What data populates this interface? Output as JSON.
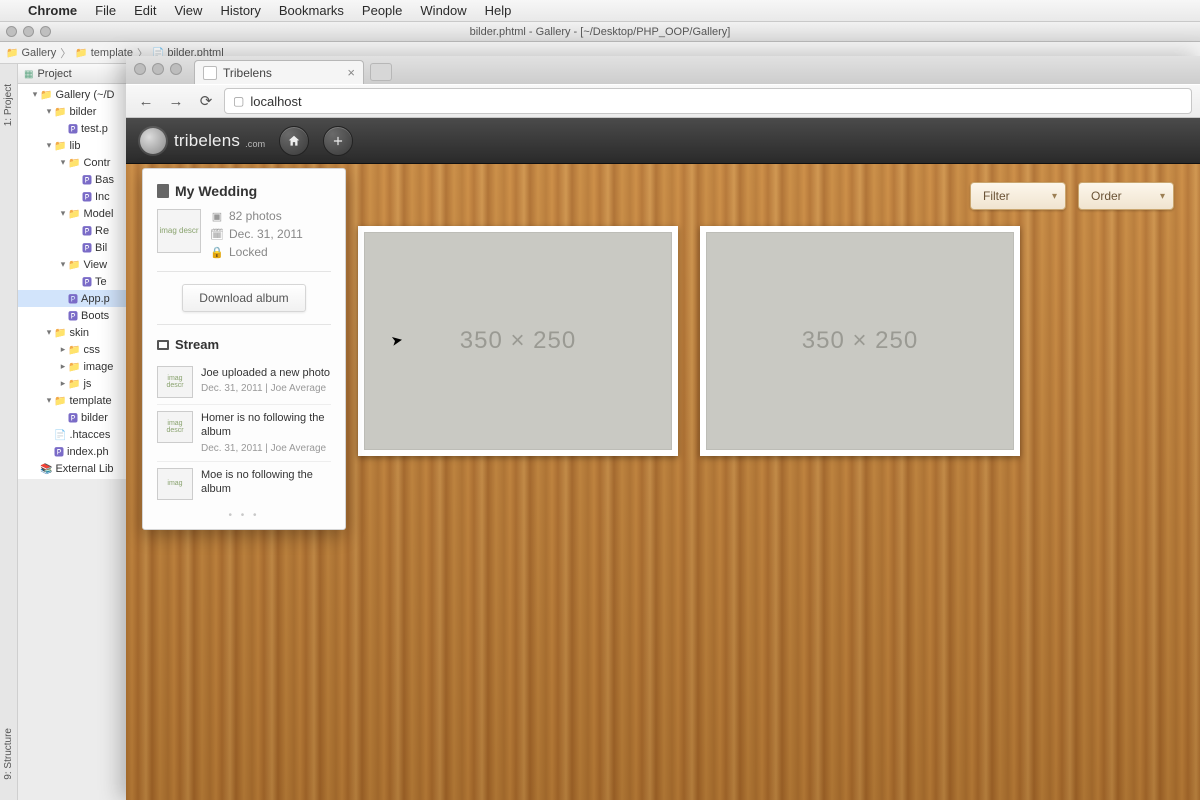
{
  "mac_menu": {
    "app": "Chrome",
    "items": [
      "File",
      "Edit",
      "View",
      "History",
      "Bookmarks",
      "People",
      "Window",
      "Help"
    ]
  },
  "ide": {
    "title": "bilder.phtml - Gallery - [~/Desktop/PHP_OOP/Gallery]",
    "breadcrumb": [
      "Gallery",
      "template",
      "bilder.phtml"
    ],
    "project_label": "Project",
    "left_tabs": [
      "1: Project",
      "9: Structure"
    ],
    "tree": [
      {
        "d": 1,
        "tw": "▾",
        "icon": "folder",
        "label": "Gallery (~/D"
      },
      {
        "d": 2,
        "tw": "▾",
        "icon": "folder",
        "label": "bilder"
      },
      {
        "d": 3,
        "tw": "",
        "icon": "php",
        "label": "test.p"
      },
      {
        "d": 2,
        "tw": "▾",
        "icon": "folder",
        "label": "lib"
      },
      {
        "d": 3,
        "tw": "▾",
        "icon": "folder",
        "label": "Contr"
      },
      {
        "d": 4,
        "tw": "",
        "icon": "php",
        "label": "Bas"
      },
      {
        "d": 4,
        "tw": "",
        "icon": "php",
        "label": "Inc"
      },
      {
        "d": 3,
        "tw": "▾",
        "icon": "folder",
        "label": "Model"
      },
      {
        "d": 4,
        "tw": "",
        "icon": "php",
        "label": "Re"
      },
      {
        "d": 4,
        "tw": "",
        "icon": "php",
        "label": "Bil"
      },
      {
        "d": 3,
        "tw": "▾",
        "icon": "folder",
        "label": "View"
      },
      {
        "d": 4,
        "tw": "",
        "icon": "php",
        "label": "Te"
      },
      {
        "d": 3,
        "tw": "",
        "icon": "php",
        "label": "App.p",
        "sel": true
      },
      {
        "d": 3,
        "tw": "",
        "icon": "php",
        "label": "Boots"
      },
      {
        "d": 2,
        "tw": "▾",
        "icon": "folder",
        "label": "skin"
      },
      {
        "d": 3,
        "tw": "▸",
        "icon": "folder",
        "label": "css"
      },
      {
        "d": 3,
        "tw": "▸",
        "icon": "folder",
        "label": "image"
      },
      {
        "d": 3,
        "tw": "▸",
        "icon": "folder",
        "label": "js"
      },
      {
        "d": 2,
        "tw": "▾",
        "icon": "folder",
        "label": "template"
      },
      {
        "d": 3,
        "tw": "",
        "icon": "php",
        "label": "bilder"
      },
      {
        "d": 2,
        "tw": "",
        "icon": "file",
        "label": ".htacces"
      },
      {
        "d": 2,
        "tw": "",
        "icon": "php",
        "label": "index.ph"
      },
      {
        "d": 1,
        "tw": "",
        "icon": "lib",
        "label": "External Lib"
      }
    ]
  },
  "chrome": {
    "tab_title": "Tribelens",
    "url": "localhost"
  },
  "app": {
    "brand": "tribelens",
    "brand_suffix": ".com",
    "filter_label": "Filter",
    "order_label": "Order",
    "placeholder_text": "350 × 250",
    "album": {
      "title": "My Wedding",
      "thumb_alt": "imag descr",
      "photos": "82 photos",
      "date": "Dec. 31, 2011",
      "lock": "Locked",
      "download": "Download album"
    },
    "stream_title": "Stream",
    "stream": [
      {
        "thumb": "imag descr",
        "text": "Joe uploaded a new photo",
        "sub": "Dec. 31, 2011 | Joe Average"
      },
      {
        "thumb": "imag descr",
        "text": "Homer is no following the album",
        "sub": "Dec. 31, 2011 | Joe Average"
      },
      {
        "thumb": "imag",
        "text": "Moe is no following the album",
        "sub": ""
      }
    ]
  }
}
